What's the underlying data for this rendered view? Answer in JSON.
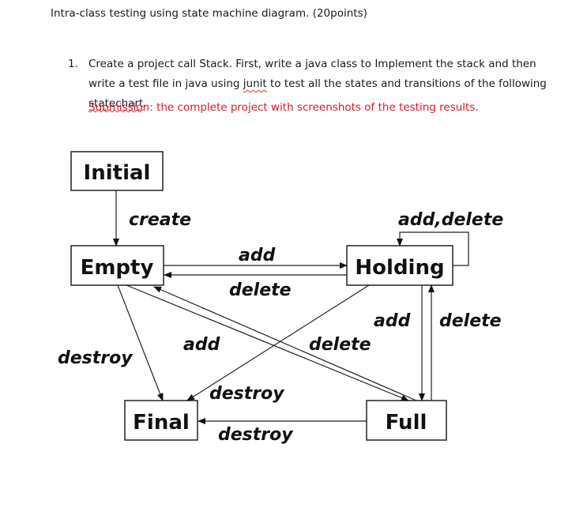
{
  "document": {
    "heading": "Intra-class testing using state machine diagram. (20points)",
    "item_number": "1.",
    "item_text_parts": {
      "part1": "Create a project call Stack. First, write a java class to Implement the stack and then write a test file in java using ",
      "junit": "junit",
      "part2": " to test all the states and transitions of the following ",
      "statechart": "statechart",
      "part3": "."
    },
    "submission": "Submission: the complete project with screenshots of the testing results.",
    "submission_color": "#e0161e"
  },
  "diagram": {
    "states": {
      "initial": "Initial",
      "empty": "Empty",
      "holding": "Holding",
      "final": "Final",
      "full": "Full"
    },
    "transitions": {
      "initial_to_empty": "create",
      "empty_to_holding": "add",
      "holding_to_empty": "delete",
      "holding_self": "add,delete",
      "holding_to_full": "add",
      "full_to_holding": "delete",
      "empty_to_final": "destroy",
      "empty_to_full": "add",
      "full_to_empty": "delete",
      "holding_to_final": "destroy",
      "full_to_final": "destroy"
    }
  }
}
